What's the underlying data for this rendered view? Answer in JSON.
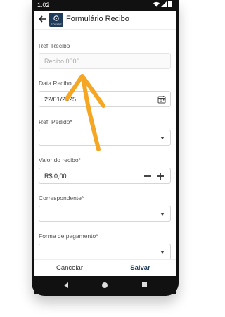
{
  "status_bar": {
    "time": "1:02",
    "icons": [
      "wifi-icon",
      "signal-icon",
      "battery-icon"
    ]
  },
  "app_bar": {
    "title": "Formulário Recibo",
    "logo_text": "EOSIBE"
  },
  "form": {
    "ref_recibo": {
      "label": "Ref. Recibo",
      "placeholder": "Recibo 0006"
    },
    "data_recibo": {
      "label": "Data Recibo",
      "value": "22/01/2025"
    },
    "ref_pedido": {
      "label": "Ref. Pedido*",
      "value": ""
    },
    "valor": {
      "label": "Valor do recibo*",
      "value": "R$ 0,00"
    },
    "correspondente": {
      "label": "Correspondente*",
      "value": ""
    },
    "forma_pagamento": {
      "label": "Forma de pagamento*",
      "value": ""
    }
  },
  "actions": {
    "cancel_label": "Cancelar",
    "save_label": "Salvar"
  },
  "annotation": {
    "color": "#F5A623",
    "icon": "arrow-up-annotation"
  },
  "colors": {
    "brand": "#1f3b5a",
    "phone_frame": "#111111"
  }
}
